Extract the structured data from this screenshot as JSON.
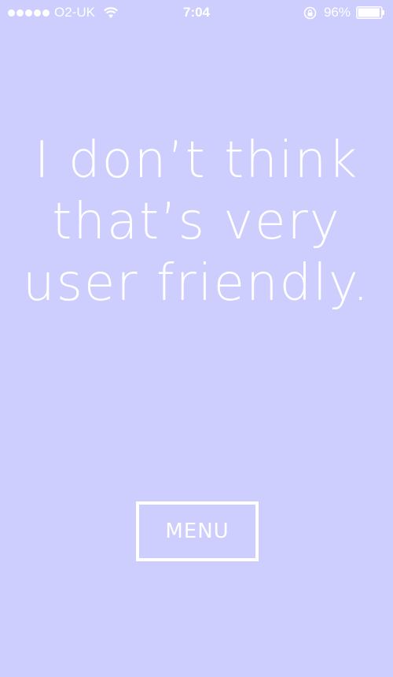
{
  "status_bar": {
    "carrier": "O2-UK",
    "time": "7:04",
    "battery_percent": "96%",
    "signal_icon": "signal-dots-icon",
    "wifi_icon": "wifi-icon",
    "rotation_lock_icon": "rotation-lock-icon",
    "battery_icon": "battery-icon",
    "battery_level": 0.96
  },
  "headline": {
    "lines": [
      "I don’t think",
      "that’s very",
      "user friendly."
    ]
  },
  "menu_button": {
    "label": "MENU"
  },
  "colors": {
    "background": "#cdcdfe",
    "foreground": "#ffffff"
  }
}
